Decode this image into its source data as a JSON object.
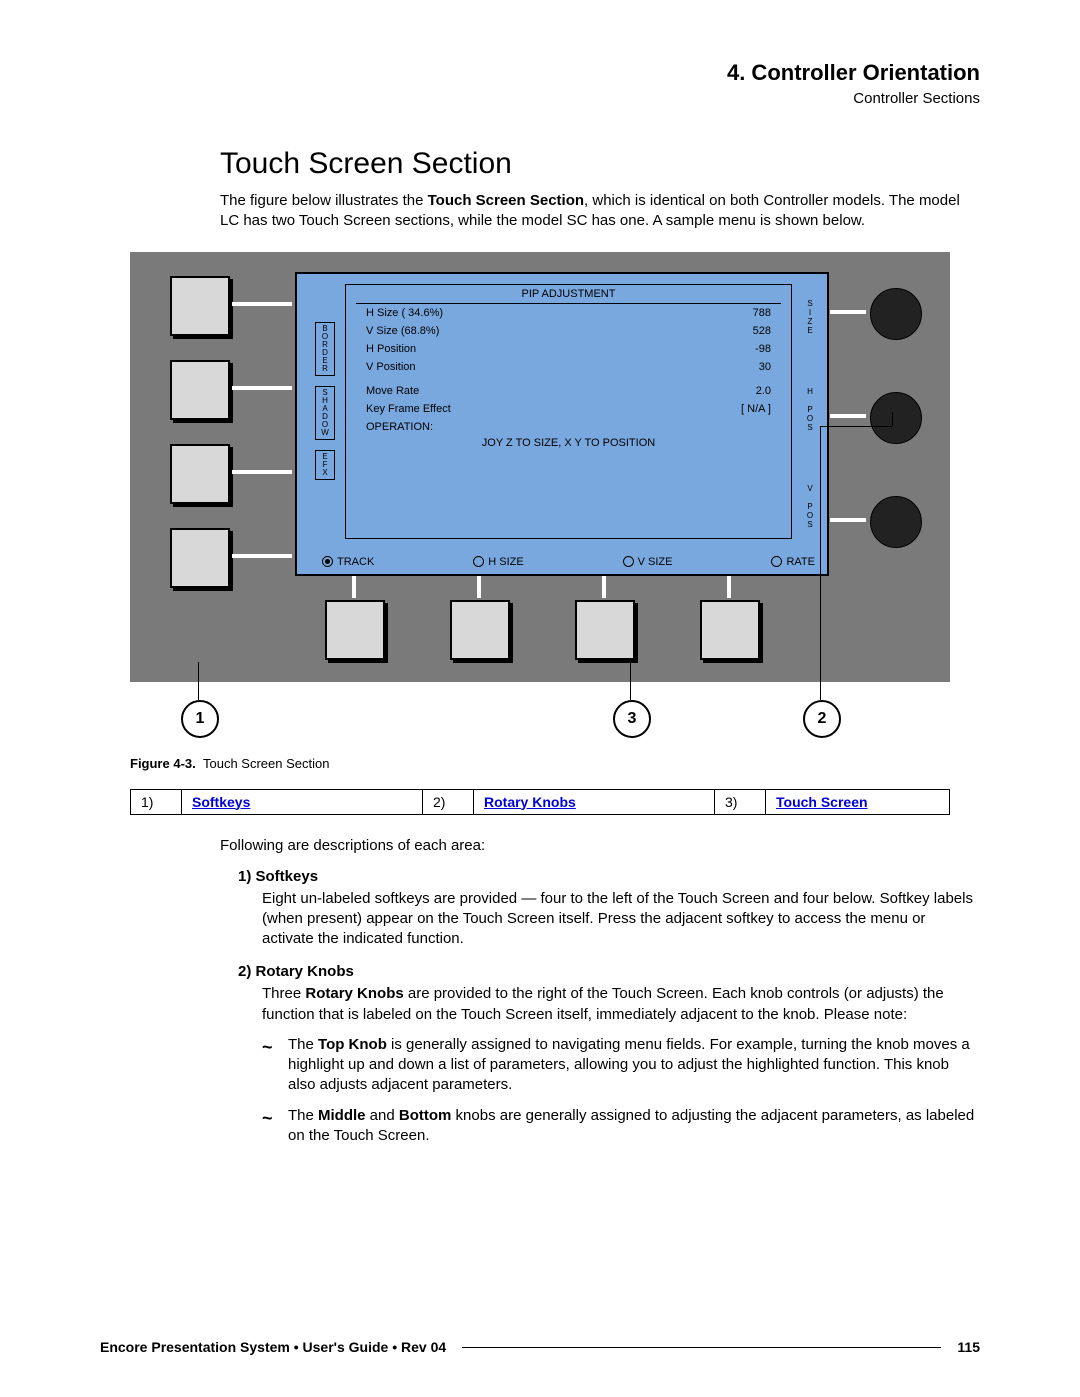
{
  "header": {
    "chapter": "4.  Controller Orientation",
    "section": "Controller Sections"
  },
  "section_heading": "Touch Screen Section",
  "intro_text_1": "The figure below illustrates the ",
  "intro_bold": "Touch Screen Section",
  "intro_text_2": ", which is identical on both Controller models.  The model LC has two Touch Screen sections, while the model SC has one.  A sample menu is shown below.",
  "touchscreen": {
    "title": "PIP ADJUSTMENT",
    "rows": [
      {
        "label": "H Size ( 34.6%)",
        "value": "788"
      },
      {
        "label": "V Size (68.8%)",
        "value": "528"
      },
      {
        "label": "H Position",
        "value": "-98"
      },
      {
        "label": "V Position",
        "value": "30"
      },
      {
        "label": "",
        "value": ""
      },
      {
        "label": "Move Rate",
        "value": "2.0"
      },
      {
        "label": "Key Frame Effect",
        "value": "[ N/A ]"
      },
      {
        "label": "OPERATION:",
        "value": ""
      }
    ],
    "op_hint": "JOY Z TO SIZE, X Y TO POSITION",
    "left_labels": [
      "BORDER",
      "SHADOW",
      "EFX"
    ],
    "right_labels": [
      "SIZE",
      "H POS",
      "V POS"
    ],
    "bottom": [
      "TRACK",
      "H SIZE",
      "V SIZE",
      "RATE"
    ]
  },
  "callouts": {
    "c1": "1",
    "c2": "2",
    "c3": "3"
  },
  "fig_caption_label": "Figure 4-3.",
  "fig_caption_text": "Touch Screen Section",
  "legend": [
    {
      "num": "1)",
      "label": "Softkeys"
    },
    {
      "num": "2)",
      "label": "Rotary Knobs"
    },
    {
      "num": "3)",
      "label": "Touch Screen"
    }
  ],
  "following_line": "Following are descriptions of each area:",
  "item1_head": "1)   Softkeys",
  "item1_body": "Eight un-labeled softkeys are provided — four to the left of the Touch Screen and four below.  Softkey labels (when present) appear on the Touch Screen itself.  Press the adjacent softkey to access the menu or activate the indicated function.",
  "item2_head": "2)   Rotary Knobs",
  "item2_pre": "Three ",
  "item2_bold1": "Rotary Knobs",
  "item2_mid": " are provided to the right of the Touch Screen.  Each knob controls (or adjusts) the function that is labeled on the Touch Screen itself, immediately adjacent to the knob.  Please note:",
  "sub1_pre": "The ",
  "sub1_b": "Top Knob",
  "sub1_rest": " is generally assigned to navigating menu fields.  For example, turning the knob moves a highlight up and down a list of parameters, allowing you to adjust the highlighted function.  This knob also adjusts adjacent parameters.",
  "sub2_pre": "The ",
  "sub2_b1": "Middle",
  "sub2_mid": " and ",
  "sub2_b2": "Bottom",
  "sub2_rest": " knobs are generally assigned to adjusting the adjacent parameters, as labeled on the Touch Screen.",
  "footer": {
    "title": "Encore Presentation System  •  User's Guide  •  Rev 04",
    "page": "115"
  }
}
